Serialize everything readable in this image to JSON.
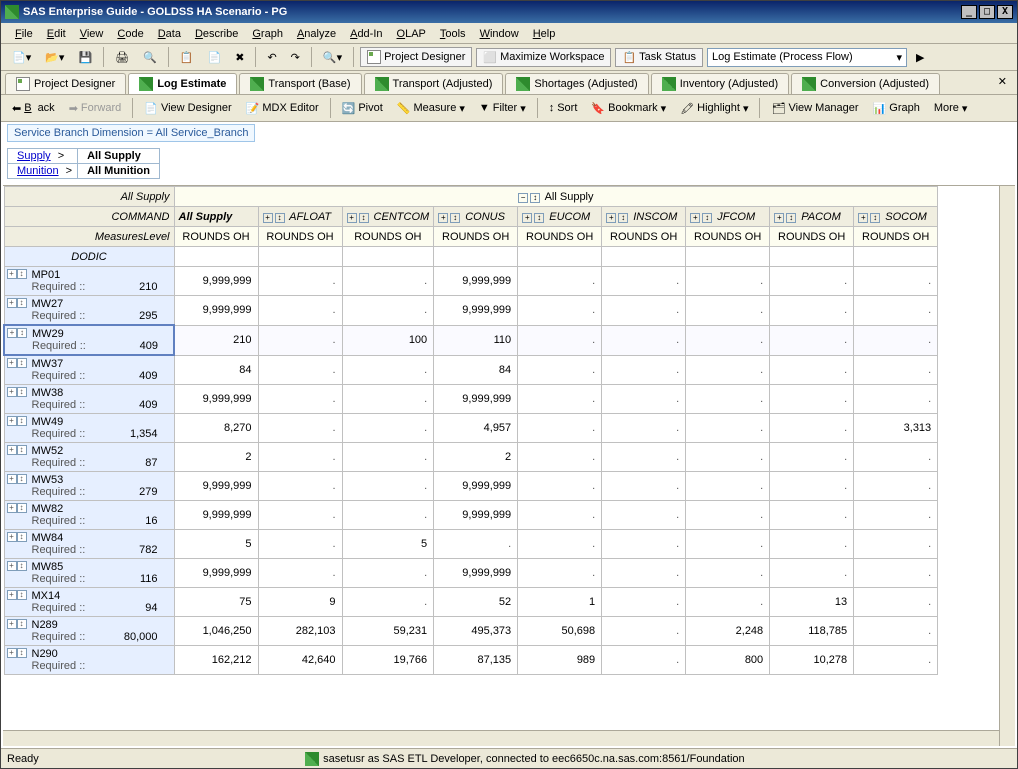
{
  "title": "SAS Enterprise Guide - GOLDSS HA Scenario - PG",
  "menu": [
    "File",
    "Edit",
    "View",
    "Code",
    "Data",
    "Describe",
    "Graph",
    "Analyze",
    "Add-In",
    "OLAP",
    "Tools",
    "Window",
    "Help"
  ],
  "toolbar1": {
    "project_designer": "Project Designer",
    "maximize": "Maximize Workspace",
    "task_status": "Task Status",
    "dropdown": "Log Estimate (Process Flow)"
  },
  "tabs": [
    {
      "label": "Project Designer",
      "active": false
    },
    {
      "label": "Log Estimate",
      "active": true
    },
    {
      "label": "Transport  (Base)",
      "active": false
    },
    {
      "label": "Transport  (Adjusted)",
      "active": false
    },
    {
      "label": "Shortages (Adjusted)",
      "active": false
    },
    {
      "label": "Inventory (Adjusted)",
      "active": false
    },
    {
      "label": "Conversion (Adjusted)",
      "active": false
    }
  ],
  "toolbar2": {
    "back": "Back",
    "forward": "Forward",
    "view_designer": "View Designer",
    "mdx": "MDX Editor",
    "pivot": "Pivot",
    "measure": "Measure",
    "filter": "Filter",
    "sort": "Sort",
    "bookmark": "Bookmark",
    "highlight": "Highlight",
    "view_manager": "View Manager",
    "graph": "Graph",
    "more": "More"
  },
  "filter_text": "Service Branch Dimension = All Service_Branch",
  "breadcrumb": {
    "supply_link": "Supply",
    "supply_cur": "All Supply",
    "munition_link": "Munition",
    "munition_cur": "All Munition"
  },
  "grid": {
    "corner1": "All Supply",
    "corner2": "COMMAND",
    "corner3": "MeasuresLevel",
    "row_group": "DODIC",
    "top_span": "All Supply",
    "columns": [
      "All Supply",
      "AFLOAT",
      "CENTCOM",
      "CONUS",
      "EUCOM",
      "INSCOM",
      "JFCOM",
      "PACOM",
      "SOCOM"
    ],
    "sub": "ROUNDS OH",
    "required_label": "Required ::",
    "rows": [
      {
        "dodic": "MP01",
        "req": "210",
        "v": [
          "9,999,999",
          ".",
          ".",
          "9,999,999",
          ".",
          ".",
          ".",
          ".",
          "."
        ]
      },
      {
        "dodic": "MW27",
        "req": "295",
        "v": [
          "9,999,999",
          ".",
          ".",
          "9,999,999",
          ".",
          ".",
          ".",
          ".",
          "."
        ]
      },
      {
        "dodic": "MW29",
        "req": "409",
        "v": [
          "210",
          ".",
          "100",
          "110",
          ".",
          ".",
          ".",
          ".",
          "."
        ],
        "sel": true
      },
      {
        "dodic": "MW37",
        "req": "409",
        "v": [
          "84",
          ".",
          ".",
          "84",
          ".",
          ".",
          ".",
          ".",
          "."
        ]
      },
      {
        "dodic": "MW38",
        "req": "409",
        "v": [
          "9,999,999",
          ".",
          ".",
          "9,999,999",
          ".",
          ".",
          ".",
          ".",
          "."
        ]
      },
      {
        "dodic": "MW49",
        "req": "1,354",
        "v": [
          "8,270",
          ".",
          ".",
          "4,957",
          ".",
          ".",
          ".",
          ".",
          "3,313"
        ]
      },
      {
        "dodic": "MW52",
        "req": "87",
        "v": [
          "2",
          ".",
          ".",
          "2",
          ".",
          ".",
          ".",
          ".",
          "."
        ]
      },
      {
        "dodic": "MW53",
        "req": "279",
        "v": [
          "9,999,999",
          ".",
          ".",
          "9,999,999",
          ".",
          ".",
          ".",
          ".",
          "."
        ]
      },
      {
        "dodic": "MW82",
        "req": "16",
        "v": [
          "9,999,999",
          ".",
          ".",
          "9,999,999",
          ".",
          ".",
          ".",
          ".",
          "."
        ]
      },
      {
        "dodic": "MW84",
        "req": "782",
        "v": [
          "5",
          ".",
          "5",
          ".",
          ".",
          ".",
          ".",
          ".",
          "."
        ]
      },
      {
        "dodic": "MW85",
        "req": "116",
        "v": [
          "9,999,999",
          ".",
          ".",
          "9,999,999",
          ".",
          ".",
          ".",
          ".",
          "."
        ]
      },
      {
        "dodic": "MX14",
        "req": "94",
        "v": [
          "75",
          "9",
          ".",
          "52",
          "1",
          ".",
          ".",
          "13",
          "."
        ]
      },
      {
        "dodic": "N289",
        "req": "80,000",
        "v": [
          "1,046,250",
          "282,103",
          "59,231",
          "495,373",
          "50,698",
          ".",
          "2,248",
          "118,785",
          "."
        ]
      },
      {
        "dodic": "N290",
        "req": "",
        "v": [
          "162,212",
          "42,640",
          "19,766",
          "87,135",
          "989",
          ".",
          "800",
          "10,278",
          "."
        ]
      }
    ]
  },
  "status": {
    "ready": "Ready",
    "conn": "sasetusr as SAS ETL Developer, connected to eec6650c.na.sas.com:8561/Foundation"
  }
}
